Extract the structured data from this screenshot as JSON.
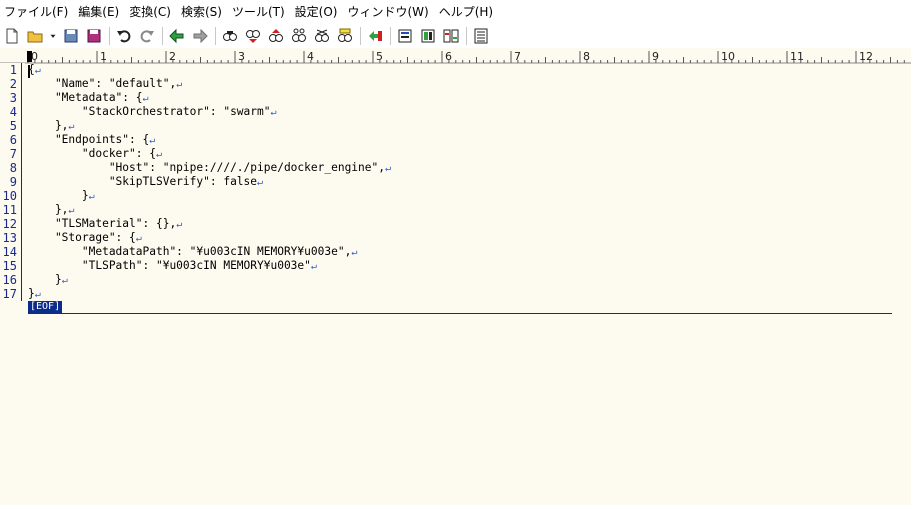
{
  "menu": [
    "ファイル(F)",
    "編集(E)",
    "変換(C)",
    "検索(S)",
    "ツール(T)",
    "設定(O)",
    "ウィンドウ(W)",
    "ヘルプ(H)"
  ],
  "toolbar": {
    "groups": [
      [
        "new-file-icon",
        "open-file-icon",
        "dropdown-arrow-icon",
        "save-icon",
        "save-all-icon"
      ],
      [
        "undo-icon",
        "redo-icon"
      ],
      [
        "back-icon",
        "forward-icon"
      ],
      [
        "search-icon",
        "search-down-icon",
        "search-up-icon",
        "search-next-icon",
        "replace-icon",
        "highlight-icon"
      ],
      [
        "tag-jump-icon"
      ],
      [
        "grep-icon",
        "grep-replace-icon",
        "compare-icon"
      ],
      [
        "outline-icon"
      ]
    ]
  },
  "ruler": {
    "labels": [
      "0",
      "1",
      "2",
      "3",
      "4",
      "5",
      "6",
      "7",
      "8",
      "9",
      "10",
      "11",
      "12"
    ]
  },
  "editor": {
    "line_numbers": [
      "1",
      "2",
      "3",
      "4",
      "5",
      "6",
      "7",
      "8",
      "9",
      "10",
      "11",
      "12",
      "13",
      "14",
      "15",
      "16",
      "17"
    ],
    "lines": [
      "{",
      "    \"Name\": \"default\",",
      "    \"Metadata\": {",
      "        \"StackOrchestrator\": \"swarm\"",
      "    },",
      "    \"Endpoints\": {",
      "        \"docker\": {",
      "            \"Host\": \"npipe:////./pipe/docker_engine\",",
      "            \"SkipTLSVerify\": false",
      "        }",
      "    },",
      "    \"TLSMaterial\": {},",
      "    \"Storage\": {",
      "        \"MetadataPath\": \"¥u003cIN MEMORY¥u003e\",",
      "        \"TLSPath\": \"¥u003cIN MEMORY¥u003e\"",
      "    }",
      "}"
    ],
    "newline_mark": "↵",
    "eof_label": "[EOF]"
  }
}
